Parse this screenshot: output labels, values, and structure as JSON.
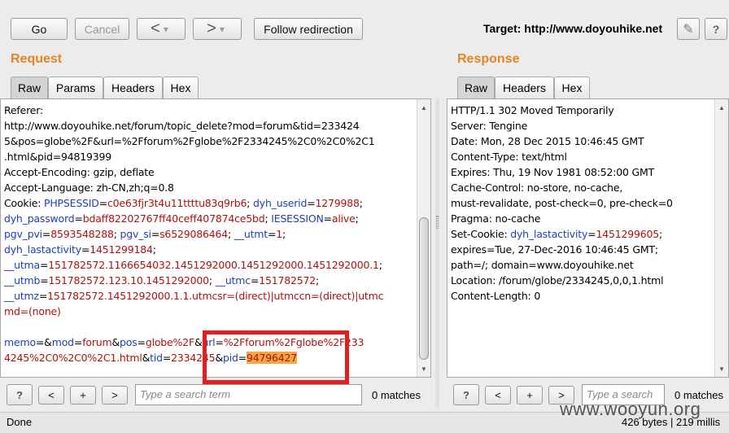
{
  "toolbar": {
    "go": "Go",
    "cancel": "Cancel",
    "back_arrow": "<",
    "fwd_arrow": ">",
    "dropdown_arrow": "▾",
    "follow_redirection": "Follow redirection",
    "target": "Target: http://www.doyouhike.net",
    "pencil_icon": "✎",
    "help": "?"
  },
  "request": {
    "heading": "Request",
    "tabs": [
      "Raw",
      "Params",
      "Headers",
      "Hex"
    ],
    "lines": [
      [
        {
          "t": "Referer:"
        }
      ],
      [
        {
          "t": "http://www.doyouhike.net/forum/topic_delete?mod=forum&tid=233424"
        }
      ],
      [
        {
          "t": "5&pos=globe%2F&url=%2Fforum%2Fglobe%2F2334245%2C0%2C0%2C1"
        }
      ],
      [
        {
          "t": ".html&pid=94819399"
        }
      ],
      [
        {
          "t": "Accept-Encoding: gzip, deflate"
        }
      ],
      [
        {
          "t": "Accept-Language: zh-CN,zh;q=0.8"
        }
      ],
      [
        {
          "t": "Cookie: "
        },
        {
          "t": "PHPSESSID",
          "c": "k"
        },
        {
          "t": "="
        },
        {
          "t": "c0e63fjr3t4u11ttttu83q9rb6",
          "c": "v"
        },
        {
          "t": "; "
        },
        {
          "t": "dyh_userid",
          "c": "k"
        },
        {
          "t": "="
        },
        {
          "t": "1279988",
          "c": "v"
        },
        {
          "t": ";"
        }
      ],
      [
        {
          "t": "dyh_password",
          "c": "k"
        },
        {
          "t": "="
        },
        {
          "t": "bdaff82202767ff40ceff407874ce5bd",
          "c": "v"
        },
        {
          "t": "; "
        },
        {
          "t": "IESESSION",
          "c": "k"
        },
        {
          "t": "="
        },
        {
          "t": "alive",
          "c": "v"
        },
        {
          "t": ";"
        }
      ],
      [
        {
          "t": "pgv_pvi",
          "c": "k"
        },
        {
          "t": "="
        },
        {
          "t": "8593548288",
          "c": "v"
        },
        {
          "t": "; "
        },
        {
          "t": "pgv_si",
          "c": "k"
        },
        {
          "t": "="
        },
        {
          "t": "s6529086464",
          "c": "v"
        },
        {
          "t": "; "
        },
        {
          "t": "__utmt",
          "c": "k"
        },
        {
          "t": "="
        },
        {
          "t": "1",
          "c": "v"
        },
        {
          "t": ";"
        }
      ],
      [
        {
          "t": "dyh_lastactivity",
          "c": "k"
        },
        {
          "t": "="
        },
        {
          "t": "1451299184",
          "c": "v"
        },
        {
          "t": ";"
        }
      ],
      [
        {
          "t": "__utma",
          "c": "k"
        },
        {
          "t": "="
        },
        {
          "t": "151782572.1166654032.1451292000.1451292000.1451292000.1",
          "c": "v"
        },
        {
          "t": ";"
        }
      ],
      [
        {
          "t": "__utmb",
          "c": "k"
        },
        {
          "t": "="
        },
        {
          "t": "151782572.123.10.1451292000",
          "c": "v"
        },
        {
          "t": "; "
        },
        {
          "t": "__utmc",
          "c": "k"
        },
        {
          "t": "="
        },
        {
          "t": "151782572",
          "c": "v"
        },
        {
          "t": ";"
        }
      ],
      [
        {
          "t": "__utmz",
          "c": "k"
        },
        {
          "t": "="
        },
        {
          "t": "151782572.1451292000.1.1.utmcsr=(direct)|utmccn=(direct)|utmc",
          "c": "v"
        }
      ],
      [
        {
          "t": "md=(none)",
          "c": "v"
        }
      ],
      [
        {
          "t": ""
        }
      ],
      [
        {
          "t": "memo",
          "c": "k"
        },
        {
          "t": "=&"
        },
        {
          "t": "mod",
          "c": "k"
        },
        {
          "t": "="
        },
        {
          "t": "forum",
          "c": "v"
        },
        {
          "t": "&"
        },
        {
          "t": "pos",
          "c": "k"
        },
        {
          "t": "="
        },
        {
          "t": "globe%2F",
          "c": "v"
        },
        {
          "t": "&"
        },
        {
          "t": "url",
          "c": "k"
        },
        {
          "t": "="
        },
        {
          "t": "%2Fforum%2Fglobe%2F233",
          "c": "v"
        }
      ],
      [
        {
          "t": "4245%2C0%2C0%2C1.html",
          "c": "v"
        },
        {
          "t": "&"
        },
        {
          "t": "tid",
          "c": "k"
        },
        {
          "t": "="
        },
        {
          "t": "2334245",
          "c": "v"
        },
        {
          "t": "&"
        },
        {
          "t": "pid",
          "c": "k"
        },
        {
          "t": "="
        },
        {
          "t": "94796427",
          "c": "hl"
        }
      ]
    ],
    "search_placeholder": "Type a search term",
    "matches": "0 matches"
  },
  "response": {
    "heading": "Response",
    "tabs": [
      "Raw",
      "Headers",
      "Hex"
    ],
    "lines": [
      [
        {
          "t": "HTTP/1.1 302 Moved Temporarily"
        }
      ],
      [
        {
          "t": "Server: Tengine"
        }
      ],
      [
        {
          "t": "Date: Mon, 28 Dec 2015 10:46:45 GMT"
        }
      ],
      [
        {
          "t": "Content-Type: text/html"
        }
      ],
      [
        {
          "t": "Expires: Thu, 19 Nov 1981 08:52:00 GMT"
        }
      ],
      [
        {
          "t": "Cache-Control: no-store, no-cache,"
        }
      ],
      [
        {
          "t": "must-revalidate, post-check=0, pre-check=0"
        }
      ],
      [
        {
          "t": "Pragma: no-cache"
        }
      ],
      [
        {
          "t": "Set-Cookie: "
        },
        {
          "t": "dyh_lastactivity",
          "c": "k"
        },
        {
          "t": "="
        },
        {
          "t": "1451299605",
          "c": "v"
        },
        {
          "t": ";"
        }
      ],
      [
        {
          "t": "expires=Tue, 27-Dec-2016 10:46:45 GMT;"
        }
      ],
      [
        {
          "t": "path=/; domain=www.doyouhike.net"
        }
      ],
      [
        {
          "t": "Location: /forum/globe/2334245,0,0,1.html"
        }
      ],
      [
        {
          "t": "Content-Length: 0"
        }
      ]
    ],
    "search_placeholder": "Type a search",
    "matches": "0 matches"
  },
  "search_controls": {
    "help": "?",
    "prev": "<",
    "add": "+",
    "next": ">"
  },
  "status": {
    "left": "Done",
    "right": "426 bytes | 219 millis"
  },
  "watermark": "www.wooyun.org",
  "colors": {
    "accent": "#e8831f",
    "param_name": "#1f3fb8",
    "param_value": "#b01010",
    "highlight": "#f5a742",
    "annotation": "#e02020"
  }
}
